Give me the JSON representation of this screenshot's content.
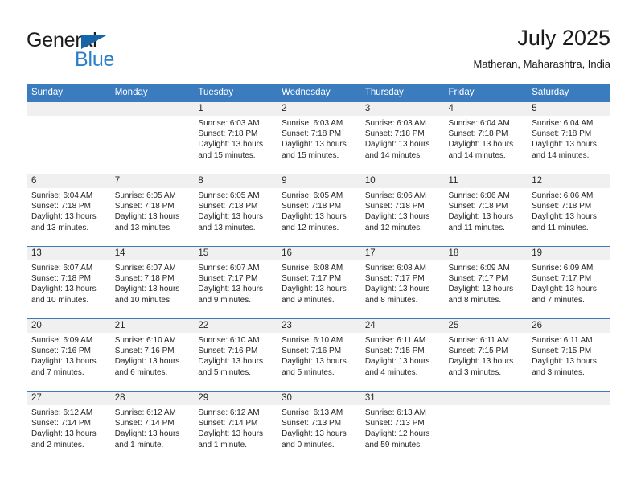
{
  "logo": {
    "line1": "General",
    "line2": "Blue",
    "triangle_color": "#1565a8",
    "blue_color": "#2a7fc9"
  },
  "header": {
    "title": "July 2025",
    "subtitle": "Matheran, Maharashtra, India"
  },
  "colors": {
    "header_row": "#3a7cbe",
    "date_band": "#f0f0f0",
    "text": "#262626"
  },
  "weekdays": [
    "Sunday",
    "Monday",
    "Tuesday",
    "Wednesday",
    "Thursday",
    "Friday",
    "Saturday"
  ],
  "weeks": [
    [
      {
        "day": "",
        "sunrise": "",
        "sunset": "",
        "daylight_1": "",
        "daylight_2": ""
      },
      {
        "day": "",
        "sunrise": "",
        "sunset": "",
        "daylight_1": "",
        "daylight_2": ""
      },
      {
        "day": "1",
        "sunrise": "Sunrise: 6:03 AM",
        "sunset": "Sunset: 7:18 PM",
        "daylight_1": "Daylight: 13 hours",
        "daylight_2": "and 15 minutes."
      },
      {
        "day": "2",
        "sunrise": "Sunrise: 6:03 AM",
        "sunset": "Sunset: 7:18 PM",
        "daylight_1": "Daylight: 13 hours",
        "daylight_2": "and 15 minutes."
      },
      {
        "day": "3",
        "sunrise": "Sunrise: 6:03 AM",
        "sunset": "Sunset: 7:18 PM",
        "daylight_1": "Daylight: 13 hours",
        "daylight_2": "and 14 minutes."
      },
      {
        "day": "4",
        "sunrise": "Sunrise: 6:04 AM",
        "sunset": "Sunset: 7:18 PM",
        "daylight_1": "Daylight: 13 hours",
        "daylight_2": "and 14 minutes."
      },
      {
        "day": "5",
        "sunrise": "Sunrise: 6:04 AM",
        "sunset": "Sunset: 7:18 PM",
        "daylight_1": "Daylight: 13 hours",
        "daylight_2": "and 14 minutes."
      }
    ],
    [
      {
        "day": "6",
        "sunrise": "Sunrise: 6:04 AM",
        "sunset": "Sunset: 7:18 PM",
        "daylight_1": "Daylight: 13 hours",
        "daylight_2": "and 13 minutes."
      },
      {
        "day": "7",
        "sunrise": "Sunrise: 6:05 AM",
        "sunset": "Sunset: 7:18 PM",
        "daylight_1": "Daylight: 13 hours",
        "daylight_2": "and 13 minutes."
      },
      {
        "day": "8",
        "sunrise": "Sunrise: 6:05 AM",
        "sunset": "Sunset: 7:18 PM",
        "daylight_1": "Daylight: 13 hours",
        "daylight_2": "and 13 minutes."
      },
      {
        "day": "9",
        "sunrise": "Sunrise: 6:05 AM",
        "sunset": "Sunset: 7:18 PM",
        "daylight_1": "Daylight: 13 hours",
        "daylight_2": "and 12 minutes."
      },
      {
        "day": "10",
        "sunrise": "Sunrise: 6:06 AM",
        "sunset": "Sunset: 7:18 PM",
        "daylight_1": "Daylight: 13 hours",
        "daylight_2": "and 12 minutes."
      },
      {
        "day": "11",
        "sunrise": "Sunrise: 6:06 AM",
        "sunset": "Sunset: 7:18 PM",
        "daylight_1": "Daylight: 13 hours",
        "daylight_2": "and 11 minutes."
      },
      {
        "day": "12",
        "sunrise": "Sunrise: 6:06 AM",
        "sunset": "Sunset: 7:18 PM",
        "daylight_1": "Daylight: 13 hours",
        "daylight_2": "and 11 minutes."
      }
    ],
    [
      {
        "day": "13",
        "sunrise": "Sunrise: 6:07 AM",
        "sunset": "Sunset: 7:18 PM",
        "daylight_1": "Daylight: 13 hours",
        "daylight_2": "and 10 minutes."
      },
      {
        "day": "14",
        "sunrise": "Sunrise: 6:07 AM",
        "sunset": "Sunset: 7:18 PM",
        "daylight_1": "Daylight: 13 hours",
        "daylight_2": "and 10 minutes."
      },
      {
        "day": "15",
        "sunrise": "Sunrise: 6:07 AM",
        "sunset": "Sunset: 7:17 PM",
        "daylight_1": "Daylight: 13 hours",
        "daylight_2": "and 9 minutes."
      },
      {
        "day": "16",
        "sunrise": "Sunrise: 6:08 AM",
        "sunset": "Sunset: 7:17 PM",
        "daylight_1": "Daylight: 13 hours",
        "daylight_2": "and 9 minutes."
      },
      {
        "day": "17",
        "sunrise": "Sunrise: 6:08 AM",
        "sunset": "Sunset: 7:17 PM",
        "daylight_1": "Daylight: 13 hours",
        "daylight_2": "and 8 minutes."
      },
      {
        "day": "18",
        "sunrise": "Sunrise: 6:09 AM",
        "sunset": "Sunset: 7:17 PM",
        "daylight_1": "Daylight: 13 hours",
        "daylight_2": "and 8 minutes."
      },
      {
        "day": "19",
        "sunrise": "Sunrise: 6:09 AM",
        "sunset": "Sunset: 7:17 PM",
        "daylight_1": "Daylight: 13 hours",
        "daylight_2": "and 7 minutes."
      }
    ],
    [
      {
        "day": "20",
        "sunrise": "Sunrise: 6:09 AM",
        "sunset": "Sunset: 7:16 PM",
        "daylight_1": "Daylight: 13 hours",
        "daylight_2": "and 7 minutes."
      },
      {
        "day": "21",
        "sunrise": "Sunrise: 6:10 AM",
        "sunset": "Sunset: 7:16 PM",
        "daylight_1": "Daylight: 13 hours",
        "daylight_2": "and 6 minutes."
      },
      {
        "day": "22",
        "sunrise": "Sunrise: 6:10 AM",
        "sunset": "Sunset: 7:16 PM",
        "daylight_1": "Daylight: 13 hours",
        "daylight_2": "and 5 minutes."
      },
      {
        "day": "23",
        "sunrise": "Sunrise: 6:10 AM",
        "sunset": "Sunset: 7:16 PM",
        "daylight_1": "Daylight: 13 hours",
        "daylight_2": "and 5 minutes."
      },
      {
        "day": "24",
        "sunrise": "Sunrise: 6:11 AM",
        "sunset": "Sunset: 7:15 PM",
        "daylight_1": "Daylight: 13 hours",
        "daylight_2": "and 4 minutes."
      },
      {
        "day": "25",
        "sunrise": "Sunrise: 6:11 AM",
        "sunset": "Sunset: 7:15 PM",
        "daylight_1": "Daylight: 13 hours",
        "daylight_2": "and 3 minutes."
      },
      {
        "day": "26",
        "sunrise": "Sunrise: 6:11 AM",
        "sunset": "Sunset: 7:15 PM",
        "daylight_1": "Daylight: 13 hours",
        "daylight_2": "and 3 minutes."
      }
    ],
    [
      {
        "day": "27",
        "sunrise": "Sunrise: 6:12 AM",
        "sunset": "Sunset: 7:14 PM",
        "daylight_1": "Daylight: 13 hours",
        "daylight_2": "and 2 minutes."
      },
      {
        "day": "28",
        "sunrise": "Sunrise: 6:12 AM",
        "sunset": "Sunset: 7:14 PM",
        "daylight_1": "Daylight: 13 hours",
        "daylight_2": "and 1 minute."
      },
      {
        "day": "29",
        "sunrise": "Sunrise: 6:12 AM",
        "sunset": "Sunset: 7:14 PM",
        "daylight_1": "Daylight: 13 hours",
        "daylight_2": "and 1 minute."
      },
      {
        "day": "30",
        "sunrise": "Sunrise: 6:13 AM",
        "sunset": "Sunset: 7:13 PM",
        "daylight_1": "Daylight: 13 hours",
        "daylight_2": "and 0 minutes."
      },
      {
        "day": "31",
        "sunrise": "Sunrise: 6:13 AM",
        "sunset": "Sunset: 7:13 PM",
        "daylight_1": "Daylight: 12 hours",
        "daylight_2": "and 59 minutes."
      },
      {
        "day": "",
        "sunrise": "",
        "sunset": "",
        "daylight_1": "",
        "daylight_2": ""
      },
      {
        "day": "",
        "sunrise": "",
        "sunset": "",
        "daylight_1": "",
        "daylight_2": ""
      }
    ]
  ]
}
